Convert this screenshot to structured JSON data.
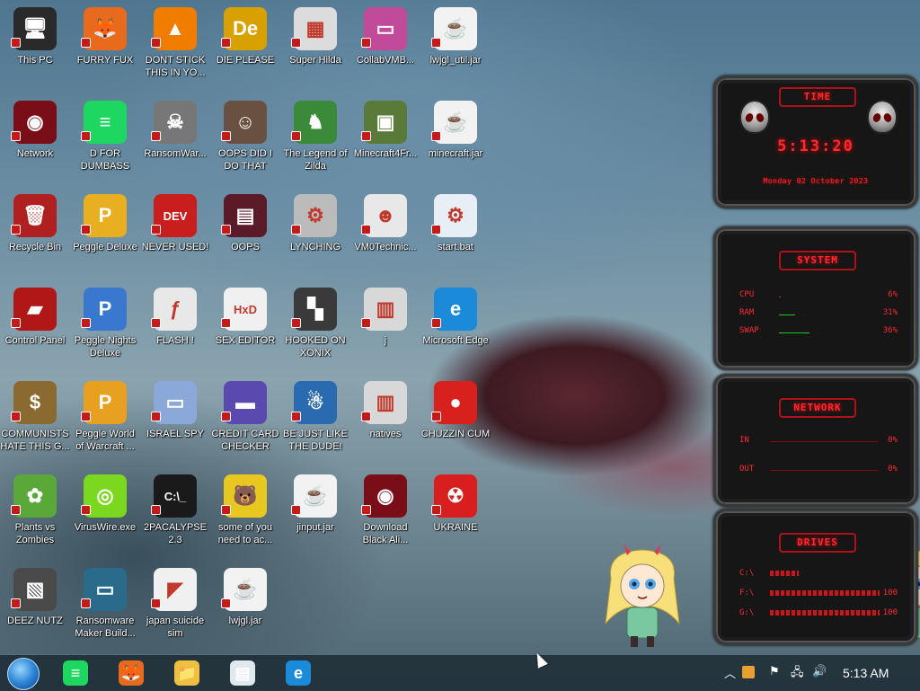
{
  "desktop": {
    "icons": [
      {
        "label": "This PC",
        "glyph": "🖥",
        "color": "#2a2a2a"
      },
      {
        "label": "FURRY FUX",
        "glyph": "🦊",
        "color": "#e86a1c"
      },
      {
        "label": "DONT STICK THIS IN YO...",
        "glyph": "▲",
        "color": "#f07d00"
      },
      {
        "label": "DIE PLEASE",
        "glyph": "De",
        "color": "#d8a000"
      },
      {
        "label": "Super Hilda",
        "glyph": "▦",
        "color": "#dcdcdc"
      },
      {
        "label": "CollabVMB...",
        "glyph": "▭",
        "color": "#c24a9a"
      },
      {
        "label": "lwjgl_util.jar",
        "glyph": "☕",
        "color": "#f2f2f2"
      },
      {
        "label": "Network",
        "glyph": "◉",
        "color": "#7a0e18"
      },
      {
        "label": "D FOR DUMBASS",
        "glyph": "≡",
        "color": "#1ed760"
      },
      {
        "label": "RansomWar...",
        "glyph": "☠",
        "color": "#777777"
      },
      {
        "label": "OOPS DID I DO THAT",
        "glyph": "☺",
        "color": "#6a5040"
      },
      {
        "label": "The Legend of Zilda",
        "glyph": "♞",
        "color": "#3a8a3a"
      },
      {
        "label": "Minecraft4Fr...",
        "glyph": "▣",
        "color": "#5a7a3a"
      },
      {
        "label": "minecraft.jar",
        "glyph": "☕",
        "color": "#f2f2f2"
      },
      {
        "label": "Recycle Bin",
        "glyph": "🗑",
        "color": "#b02020"
      },
      {
        "label": "Peggle Deluxe",
        "glyph": "P",
        "color": "#e8b020"
      },
      {
        "label": "NEVER USED!",
        "glyph": "DEV",
        "color": "#c81e1e"
      },
      {
        "label": "OOPS",
        "glyph": "▤",
        "color": "#5a1a28"
      },
      {
        "label": "LYNCHING",
        "glyph": "⚙",
        "color": "#bbbbbb"
      },
      {
        "label": "VM0Technic...",
        "glyph": "☻",
        "color": "#e8e8e8"
      },
      {
        "label": "start.bat",
        "glyph": "⚙",
        "color": "#e8eef5"
      },
      {
        "label": "Control Panel",
        "glyph": "▰",
        "color": "#b01818"
      },
      {
        "label": "Peggle Nights Deluxe",
        "glyph": "P",
        "color": "#3a78d0"
      },
      {
        "label": "FLASH !",
        "glyph": "ƒ",
        "color": "#e8e8e8"
      },
      {
        "label": "SEX EDITOR",
        "glyph": "HxD",
        "color": "#f0f0f0"
      },
      {
        "label": "HOOKED ON XONIX",
        "glyph": "▚",
        "color": "#3a3a3a"
      },
      {
        "label": "j",
        "glyph": "▥",
        "color": "#d8d8d8"
      },
      {
        "label": "Microsoft Edge",
        "glyph": "e",
        "color": "#1b8ad8"
      },
      {
        "label": "COMMUNISTS HATE THIS G...",
        "glyph": "$",
        "color": "#8a6a30"
      },
      {
        "label": "Peggle World of Warcraft ...",
        "glyph": "P",
        "color": "#e8a020"
      },
      {
        "label": "ISRAEL SPY",
        "glyph": "▭",
        "color": "#8aa8d8"
      },
      {
        "label": "CREDIT CARD CHECKER",
        "glyph": "▬",
        "color": "#5a4ab0"
      },
      {
        "label": "BE JUST LIKE THE DUDE!",
        "glyph": "☃",
        "color": "#2a6ab0"
      },
      {
        "label": "natives",
        "glyph": "▥",
        "color": "#d8d8d8"
      },
      {
        "label": "CHUZZIN CUM",
        "glyph": "●",
        "color": "#d8201c"
      },
      {
        "label": "Plants vs Zombies",
        "glyph": "✿",
        "color": "#5aa83a"
      },
      {
        "label": "VirusWire.exe",
        "glyph": "◎",
        "color": "#7ad81e"
      },
      {
        "label": "2PACALYPSE 2.3",
        "glyph": "C:\\_",
        "color": "#1a1a1a"
      },
      {
        "label": "some of you need to ac...",
        "glyph": "🐻",
        "color": "#e8c820"
      },
      {
        "label": "jinput.jar",
        "glyph": "☕",
        "color": "#f2f2f2"
      },
      {
        "label": "Download Black Ali...",
        "glyph": "◉",
        "color": "#7a0e18"
      },
      {
        "label": "UKRAINE",
        "glyph": "☢",
        "color": "#d81e1e"
      },
      {
        "label": "DEEZ NUTZ",
        "glyph": "▧",
        "color": "#4a4a4a"
      },
      {
        "label": "Ransomware Maker Build...",
        "glyph": "▭",
        "color": "#2a6a8a"
      },
      {
        "label": "japan suicide sim",
        "glyph": "◤",
        "color": "#f0f0f0"
      },
      {
        "label": "lwjgl.jar",
        "glyph": "☕",
        "color": "#f2f2f2"
      }
    ]
  },
  "widgets": {
    "time": {
      "title": "TIME",
      "clock": "5:13:20",
      "date": "Monday 02 October 2023"
    },
    "system": {
      "title": "SYSTEM",
      "rows": [
        {
          "key": "CPU",
          "value": "6%",
          "level": 0.06
        },
        {
          "key": "RAM",
          "value": "31%",
          "level": 0.31
        },
        {
          "key": "SWAP",
          "value": "36%",
          "level": 0.36
        }
      ]
    },
    "network": {
      "title": "NETWORK",
      "rows": [
        {
          "key": "IN",
          "value": "0%"
        },
        {
          "key": "OUT",
          "value": "0%"
        }
      ]
    },
    "drives": {
      "title": "DRIVES",
      "rows": [
        {
          "key": "C:\\",
          "value": "",
          "level": 0.2
        },
        {
          "key": "F:\\",
          "value": "100",
          "level": 1.0
        },
        {
          "key": "G:\\",
          "value": "100",
          "level": 1.0
        }
      ]
    }
  },
  "taskbar": {
    "pinned": [
      {
        "name": "spotify",
        "glyph": "≡",
        "color": "#1ed760"
      },
      {
        "name": "firefox",
        "glyph": "🦊",
        "color": "#e86a1c"
      },
      {
        "name": "file-explorer",
        "glyph": "📁",
        "color": "#f0c040"
      },
      {
        "name": "notepad",
        "glyph": "▤",
        "color": "#e0e8f0"
      },
      {
        "name": "edge",
        "glyph": "e",
        "color": "#1b8ad8"
      }
    ],
    "tray": {
      "clock": "5:13 AM"
    }
  },
  "accent": "#e0202a"
}
